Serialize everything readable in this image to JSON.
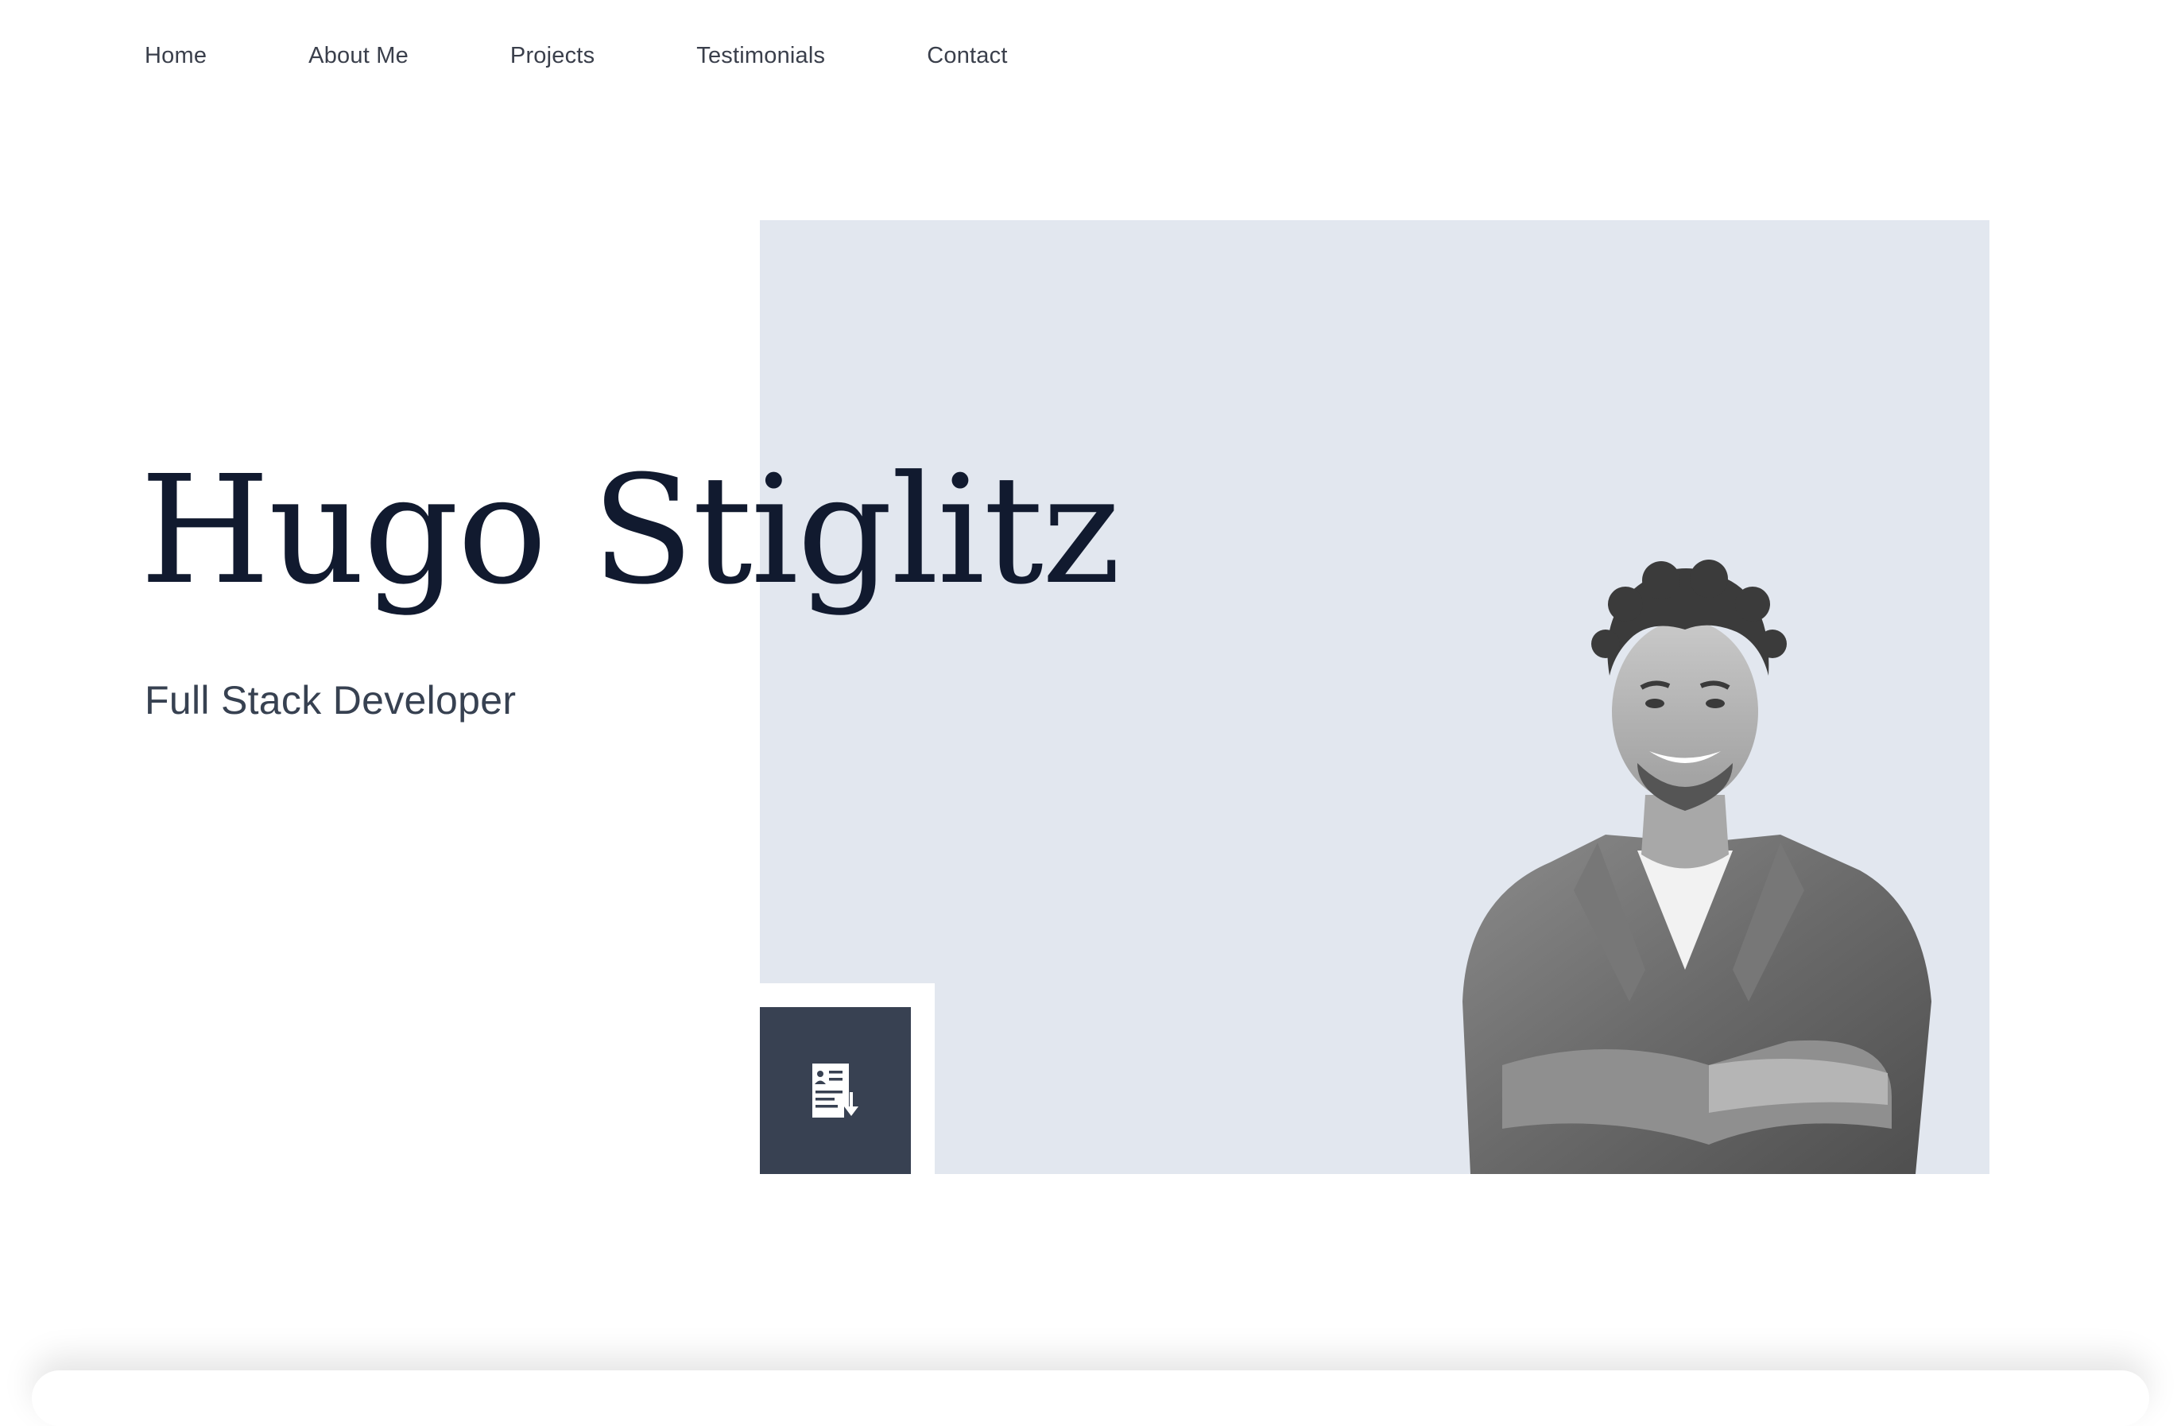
{
  "nav": {
    "items": [
      {
        "label": "Home"
      },
      {
        "label": "About Me"
      },
      {
        "label": "Projects"
      },
      {
        "label": "Testimonials"
      },
      {
        "label": "Contact"
      }
    ]
  },
  "hero": {
    "name": "Hugo Stiglitz",
    "role": "Full Stack Developer",
    "resume_icon": "resume-download-icon",
    "portrait": "portrait-photo"
  },
  "colors": {
    "hero_background": "#e2e7ef",
    "button_background": "#384152",
    "title_color": "#111a2f",
    "subtitle_color": "#374151",
    "nav_text": "#3a3f4b"
  }
}
